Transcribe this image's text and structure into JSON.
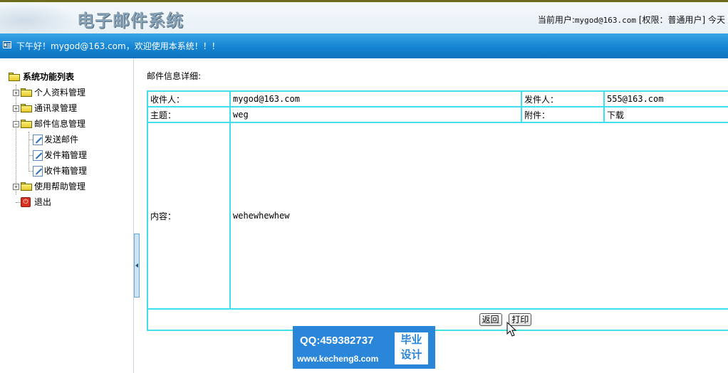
{
  "header": {
    "app_title": "电子邮件系统",
    "user_label": "当前用户:",
    "user_email": "mygod@163.com",
    "role": "[权限：普通用户]",
    "today_label": "今天"
  },
  "bluebar": {
    "greeting": "下午好！mygod@163.com，欢迎使用本系统！！！"
  },
  "sidebar": {
    "root": "系统功能列表",
    "items": [
      {
        "label": "个人资料管理"
      },
      {
        "label": "通讯录管理"
      },
      {
        "label": "邮件信息管理",
        "children": [
          {
            "label": "发送邮件"
          },
          {
            "label": "发件箱管理"
          },
          {
            "label": "收件箱管理"
          }
        ]
      },
      {
        "label": "使用帮助管理"
      },
      {
        "label": "退出"
      }
    ]
  },
  "content": {
    "section_title": "邮件信息详细:",
    "recipient_label": "收件人：",
    "recipient_value": "mygod@163.com",
    "sender_label": "发件人：",
    "sender_value": "555@163.com",
    "subject_label": "主题：",
    "subject_value": "weg",
    "attachment_label": "附件：",
    "attachment_value": "下载",
    "body_label": "内容：",
    "body_value": "wehewhewhew",
    "back_label": "返回",
    "print_label": "打印"
  },
  "watermark": {
    "qq": "QQ:459382737",
    "url": "www.kecheng8.com",
    "badge_line1": "毕业",
    "badge_line2": "设计"
  },
  "icons": [
    "folder-icon",
    "page-icon",
    "exit-icon",
    "expand-icon",
    "collapse-icon",
    "cursor-icon"
  ]
}
